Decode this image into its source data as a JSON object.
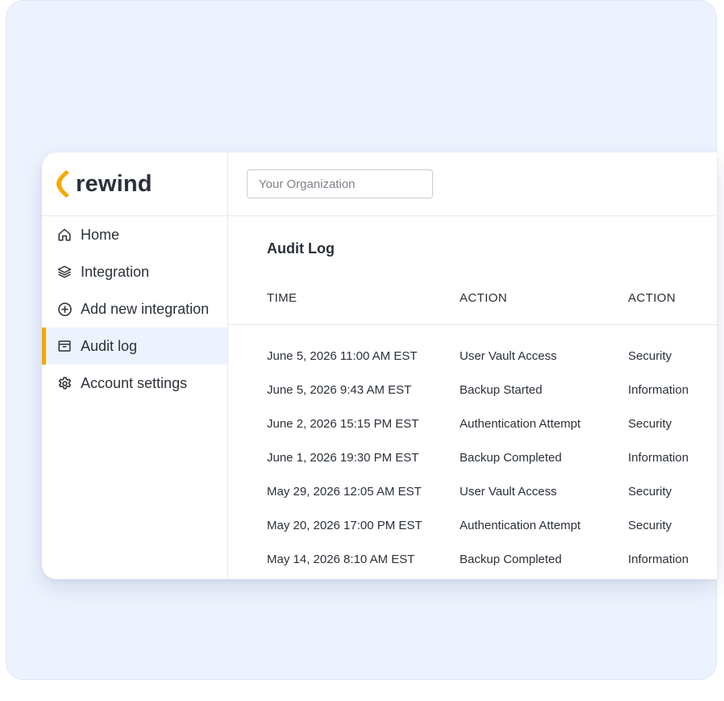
{
  "brand": {
    "name": "rewind",
    "accent": "#f5a800"
  },
  "search": {
    "placeholder": "Your Organization",
    "value": ""
  },
  "sidebar": {
    "items": [
      {
        "label": "Home",
        "icon": "home-icon",
        "active": false
      },
      {
        "label": "Integration",
        "icon": "layers-icon",
        "active": false
      },
      {
        "label": "Add new integration",
        "icon": "plus-circle-icon",
        "active": false
      },
      {
        "label": "Audit log",
        "icon": "archive-icon",
        "active": true
      },
      {
        "label": "Account settings",
        "icon": "gear-icon",
        "active": false
      }
    ]
  },
  "main": {
    "title": "Audit Log",
    "columns": [
      "TIME",
      "ACTION",
      "ACTION"
    ],
    "rows": [
      [
        "June 5, 2026 11:00 AM EST",
        "User Vault Access",
        "Security"
      ],
      [
        "June 5, 2026 9:43 AM EST",
        "Backup Started",
        "Information"
      ],
      [
        "June 2, 2026 15:15 PM EST",
        "Authentication Attempt",
        "Security"
      ],
      [
        "June 1, 2026 19:30 PM EST",
        "Backup Completed",
        "Information"
      ],
      [
        "May 29, 2026 12:05 AM EST",
        "User Vault Access",
        "Security"
      ],
      [
        "May 20, 2026 17:00 PM EST",
        "Authentication Attempt",
        "Security"
      ],
      [
        "May 14, 2026 8:10 AM EST",
        "Backup Completed",
        "Information"
      ]
    ]
  }
}
